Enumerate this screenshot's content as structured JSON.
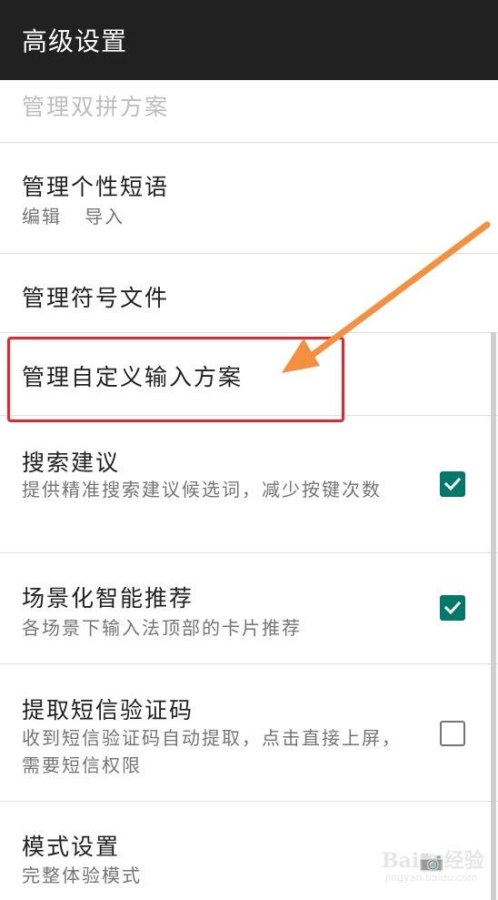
{
  "toolbar": {
    "title": "高级设置"
  },
  "items": [
    {
      "title": "管理双拼方案",
      "summary": ""
    },
    {
      "title": "管理个性短语",
      "summary": "编辑   导入"
    },
    {
      "title": "管理符号文件",
      "summary": ""
    },
    {
      "title": "管理自定义输入方案",
      "summary": ""
    },
    {
      "title": "搜索建议",
      "summary": "提供精准搜索建议候选词，减少按键次数",
      "checked": true
    },
    {
      "title": "场景化智能推荐",
      "summary": "各场景下输入法顶部的卡片推荐",
      "checked": true
    },
    {
      "title": "提取短信验证码",
      "summary": "收到短信验证码自动提取，点击直接上屏，需要短信权限",
      "checked": false
    },
    {
      "title": "模式设置",
      "summary": "完整体验模式"
    }
  ],
  "watermark": {
    "logo": "Bai📷经验",
    "sub": "jingyan.baidu.com"
  },
  "colors": {
    "toolbar": "#212121",
    "checkbox_on": "#00796b",
    "highlight": "#e8262a",
    "arrow": "#f5913e"
  }
}
